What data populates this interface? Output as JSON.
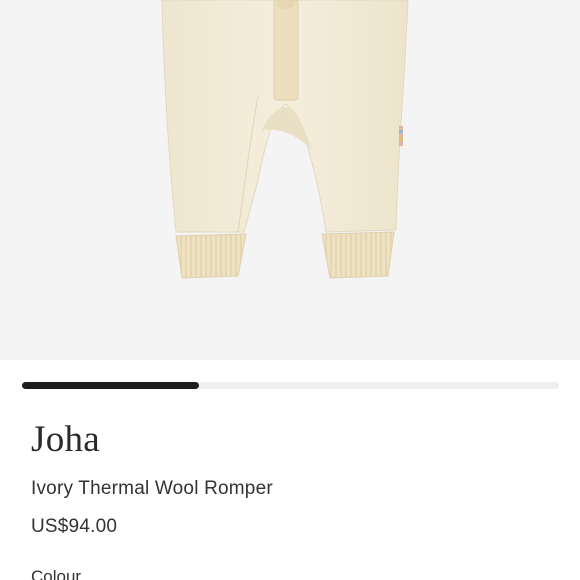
{
  "product": {
    "brand": "Joha",
    "name": "Ivory Thermal Wool Romper",
    "price": "US$94.00",
    "colour_label": "Colour"
  },
  "gallery": {
    "image_subject": "ivory-wool-romper-image",
    "progress_fraction": 0.33
  },
  "colors": {
    "gallery_background": "#f4f4f4",
    "garment": "#f3ecd8",
    "cuff": "#efe3c4",
    "progress_fill": "#1e1e1e",
    "progress_track": "#efefef"
  }
}
